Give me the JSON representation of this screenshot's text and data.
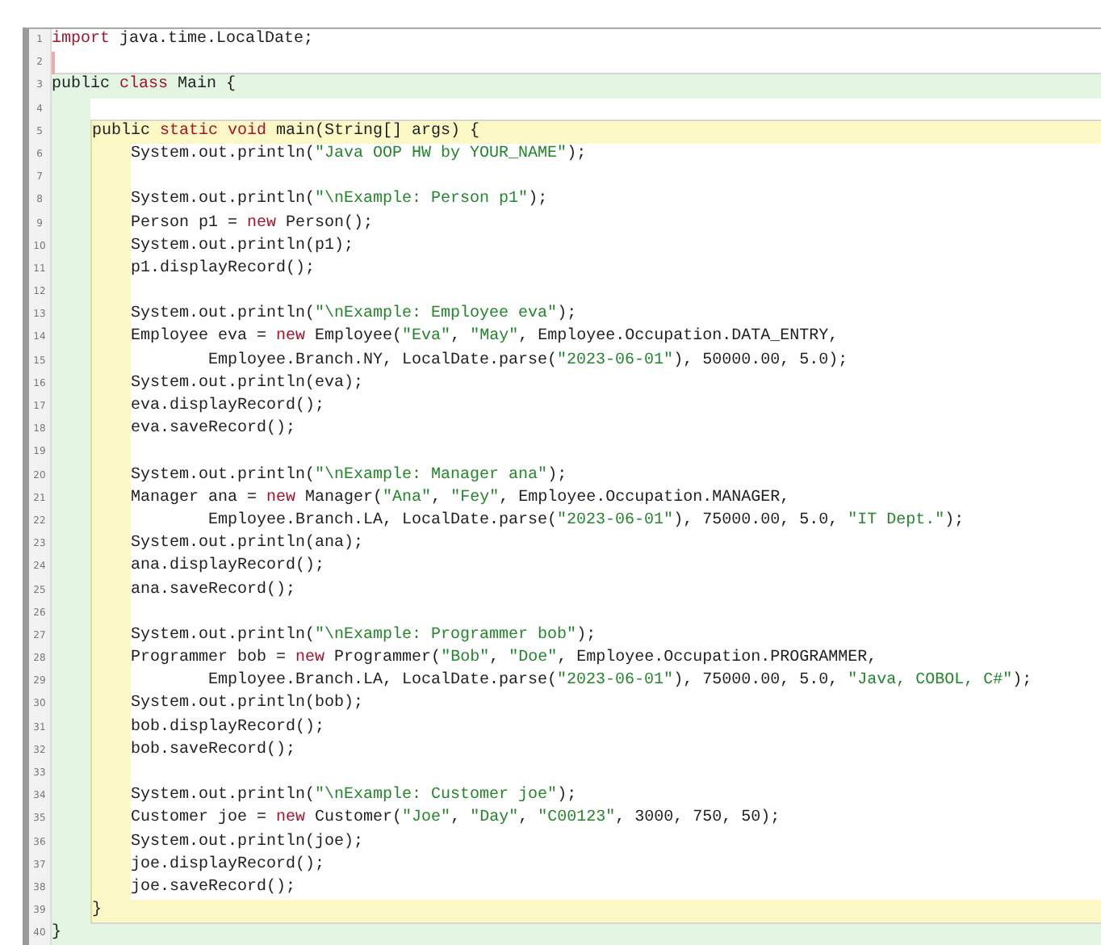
{
  "editor": {
    "items": [
      {
        "kind": "line",
        "number": "1",
        "caret": false,
        "tokens": [
          {
            "kind": "keyword",
            "text": "import"
          },
          {
            "kind": "plain",
            "text": " java.time.LocalDate;"
          }
        ]
      },
      {
        "kind": "line",
        "number": "2",
        "caret": true
      },
      {
        "kind": "block",
        "header": {
          "number": "3",
          "caret": false,
          "tokens": [
            {
              "kind": "plain",
              "text": "public "
            },
            {
              "kind": "keyword",
              "text": "class"
            },
            {
              "kind": "plain",
              "text": " Main {"
            }
          ]
        },
        "children": [
          {
            "kind": "line",
            "number": "4",
            "caret": false
          },
          {
            "kind": "block",
            "header": {
              "number": "5",
              "caret": false,
              "tokens": [
                {
                  "kind": "plain",
                  "text": "public "
                },
                {
                  "kind": "keyword",
                  "text": "static void"
                },
                {
                  "kind": "plain",
                  "text": " main(String[] args) {"
                }
              ]
            },
            "children": [
              {
                "kind": "line",
                "number": "6",
                "caret": false,
                "tokens": [
                  {
                    "kind": "plain",
                    "text": "System.out.println("
                  },
                  {
                    "kind": "string",
                    "text": "\"Java OOP HW by YOUR_NAME\""
                  },
                  {
                    "kind": "plain",
                    "text": ");"
                  }
                ]
              },
              {
                "kind": "line",
                "number": "7",
                "caret": false
              },
              {
                "kind": "line",
                "number": "8",
                "caret": false,
                "tokens": [
                  {
                    "kind": "plain",
                    "text": "System.out.println("
                  },
                  {
                    "kind": "string",
                    "text": "\"\\nExample: Person p1\""
                  },
                  {
                    "kind": "plain",
                    "text": ");"
                  }
                ]
              },
              {
                "kind": "line",
                "number": "9",
                "caret": false,
                "tokens": [
                  {
                    "kind": "plain",
                    "text": "Person p1 = "
                  },
                  {
                    "kind": "keyword",
                    "text": "new"
                  },
                  {
                    "kind": "plain",
                    "text": " Person();"
                  }
                ]
              },
              {
                "kind": "line",
                "number": "10",
                "caret": false,
                "tokens": [
                  {
                    "kind": "plain",
                    "text": "System.out.println(p1);"
                  }
                ]
              },
              {
                "kind": "line",
                "number": "11",
                "caret": false,
                "tokens": [
                  {
                    "kind": "plain",
                    "text": "p1.displayRecord();"
                  }
                ]
              },
              {
                "kind": "line",
                "number": "12",
                "caret": false
              },
              {
                "kind": "line",
                "number": "13",
                "caret": false,
                "tokens": [
                  {
                    "kind": "plain",
                    "text": "System.out.println("
                  },
                  {
                    "kind": "string",
                    "text": "\"\\nExample: Employee eva\""
                  },
                  {
                    "kind": "plain",
                    "text": ");"
                  }
                ]
              },
              {
                "kind": "line",
                "number": "14",
                "caret": false,
                "tokens": [
                  {
                    "kind": "plain",
                    "text": "Employee eva = "
                  },
                  {
                    "kind": "keyword",
                    "text": "new"
                  },
                  {
                    "kind": "plain",
                    "text": " Employee("
                  },
                  {
                    "kind": "string",
                    "text": "\"Eva\""
                  },
                  {
                    "kind": "plain",
                    "text": ", "
                  },
                  {
                    "kind": "string",
                    "text": "\"May\""
                  },
                  {
                    "kind": "plain",
                    "text": ", Employee.Occupation.DATA_ENTRY,"
                  }
                ]
              },
              {
                "kind": "continuation",
                "number": "15",
                "caret": false,
                "tokens": [
                  {
                    "kind": "plain",
                    "text": "Employee.Branch.NY, LocalDate.parse("
                  },
                  {
                    "kind": "string",
                    "text": "\"2023-06-01\""
                  },
                  {
                    "kind": "plain",
                    "text": "), 50000.00, 5.0);"
                  }
                ]
              },
              {
                "kind": "line",
                "number": "16",
                "caret": false,
                "tokens": [
                  {
                    "kind": "plain",
                    "text": "System.out.println(eva);"
                  }
                ]
              },
              {
                "kind": "line",
                "number": "17",
                "caret": false,
                "tokens": [
                  {
                    "kind": "plain",
                    "text": "eva.displayRecord();"
                  }
                ]
              },
              {
                "kind": "line",
                "number": "18",
                "caret": false,
                "tokens": [
                  {
                    "kind": "plain",
                    "text": "eva.saveRecord();"
                  }
                ]
              },
              {
                "kind": "line",
                "number": "19",
                "caret": false
              },
              {
                "kind": "line",
                "number": "20",
                "caret": false,
                "tokens": [
                  {
                    "kind": "plain",
                    "text": "System.out.println("
                  },
                  {
                    "kind": "string",
                    "text": "\"\\nExample: Manager ana\""
                  },
                  {
                    "kind": "plain",
                    "text": ");"
                  }
                ]
              },
              {
                "kind": "line",
                "number": "21",
                "caret": false,
                "tokens": [
                  {
                    "kind": "plain",
                    "text": "Manager ana = "
                  },
                  {
                    "kind": "keyword",
                    "text": "new"
                  },
                  {
                    "kind": "plain",
                    "text": " Manager("
                  },
                  {
                    "kind": "string",
                    "text": "\"Ana\""
                  },
                  {
                    "kind": "plain",
                    "text": ", "
                  },
                  {
                    "kind": "string",
                    "text": "\"Fey\""
                  },
                  {
                    "kind": "plain",
                    "text": ", Employee.Occupation.MANAGER,"
                  }
                ]
              },
              {
                "kind": "continuation",
                "number": "22",
                "caret": false,
                "tokens": [
                  {
                    "kind": "plain",
                    "text": "Employee.Branch.LA, LocalDate.parse("
                  },
                  {
                    "kind": "string",
                    "text": "\"2023-06-01\""
                  },
                  {
                    "kind": "plain",
                    "text": "), 75000.00, 5.0, "
                  },
                  {
                    "kind": "string",
                    "text": "\"IT Dept.\""
                  },
                  {
                    "kind": "plain",
                    "text": ");"
                  }
                ]
              },
              {
                "kind": "line",
                "number": "23",
                "caret": false,
                "tokens": [
                  {
                    "kind": "plain",
                    "text": "System.out.println(ana);"
                  }
                ]
              },
              {
                "kind": "line",
                "number": "24",
                "caret": false,
                "tokens": [
                  {
                    "kind": "plain",
                    "text": "ana.displayRecord();"
                  }
                ]
              },
              {
                "kind": "line",
                "number": "25",
                "caret": false,
                "tokens": [
                  {
                    "kind": "plain",
                    "text": "ana.saveRecord();"
                  }
                ]
              },
              {
                "kind": "line",
                "number": "26",
                "caret": false
              },
              {
                "kind": "line",
                "number": "27",
                "caret": false,
                "tokens": [
                  {
                    "kind": "plain",
                    "text": "System.out.println("
                  },
                  {
                    "kind": "string",
                    "text": "\"\\nExample: Programmer bob\""
                  },
                  {
                    "kind": "plain",
                    "text": ");"
                  }
                ]
              },
              {
                "kind": "line",
                "number": "28",
                "caret": false,
                "tokens": [
                  {
                    "kind": "plain",
                    "text": "Programmer bob = "
                  },
                  {
                    "kind": "keyword",
                    "text": "new"
                  },
                  {
                    "kind": "plain",
                    "text": " Programmer("
                  },
                  {
                    "kind": "string",
                    "text": "\"Bob\""
                  },
                  {
                    "kind": "plain",
                    "text": ", "
                  },
                  {
                    "kind": "string",
                    "text": "\"Doe\""
                  },
                  {
                    "kind": "plain",
                    "text": ", Employee.Occupation.PROGRAMMER,"
                  }
                ]
              },
              {
                "kind": "continuation",
                "number": "29",
                "caret": false,
                "tokens": [
                  {
                    "kind": "plain",
                    "text": "Employee.Branch.LA, LocalDate.parse("
                  },
                  {
                    "kind": "string",
                    "text": "\"2023-06-01\""
                  },
                  {
                    "kind": "plain",
                    "text": "), 75000.00, 5.0, "
                  },
                  {
                    "kind": "string",
                    "text": "\"Java, COBOL, C#\""
                  },
                  {
                    "kind": "plain",
                    "text": ");"
                  }
                ]
              },
              {
                "kind": "line",
                "number": "30",
                "caret": false,
                "tokens": [
                  {
                    "kind": "plain",
                    "text": "System.out.println(bob);"
                  }
                ]
              },
              {
                "kind": "line",
                "number": "31",
                "caret": false,
                "tokens": [
                  {
                    "kind": "plain",
                    "text": "bob.displayRecord();"
                  }
                ]
              },
              {
                "kind": "line",
                "number": "32",
                "caret": false,
                "tokens": [
                  {
                    "kind": "plain",
                    "text": "bob.saveRecord();"
                  }
                ]
              },
              {
                "kind": "line",
                "number": "33",
                "caret": false
              },
              {
                "kind": "line",
                "number": "34",
                "caret": false,
                "tokens": [
                  {
                    "kind": "plain",
                    "text": "System.out.println("
                  },
                  {
                    "kind": "string",
                    "text": "\"\\nExample: Customer joe\""
                  },
                  {
                    "kind": "plain",
                    "text": ");"
                  }
                ]
              },
              {
                "kind": "line",
                "number": "35",
                "caret": false,
                "tokens": [
                  {
                    "kind": "plain",
                    "text": "Customer joe = "
                  },
                  {
                    "kind": "keyword",
                    "text": "new"
                  },
                  {
                    "kind": "plain",
                    "text": " Customer("
                  },
                  {
                    "kind": "string",
                    "text": "\"Joe\""
                  },
                  {
                    "kind": "plain",
                    "text": ", "
                  },
                  {
                    "kind": "string",
                    "text": "\"Day\""
                  },
                  {
                    "kind": "plain",
                    "text": ", "
                  },
                  {
                    "kind": "string",
                    "text": "\"C00123\""
                  },
                  {
                    "kind": "plain",
                    "text": ", 3000, 750, 50);"
                  }
                ]
              },
              {
                "kind": "line",
                "number": "36",
                "caret": false,
                "tokens": [
                  {
                    "kind": "plain",
                    "text": "System.out.println(joe);"
                  }
                ]
              },
              {
                "kind": "line",
                "number": "37",
                "caret": false,
                "tokens": [
                  {
                    "kind": "plain",
                    "text": "joe.displayRecord();"
                  }
                ]
              },
              {
                "kind": "line",
                "number": "38",
                "caret": false,
                "tokens": [
                  {
                    "kind": "plain",
                    "text": "joe.saveRecord();"
                  }
                ]
              }
            ],
            "footer": {
              "number": "39",
              "caret": false,
              "tokens": [
                {
                  "kind": "plain",
                  "text": "}"
                }
              ]
            }
          }
        ],
        "footer": {
          "number": "40",
          "caret": false,
          "tokens": [
            {
              "kind": "plain",
              "text": "}"
            }
          ]
        }
      }
    ]
  }
}
